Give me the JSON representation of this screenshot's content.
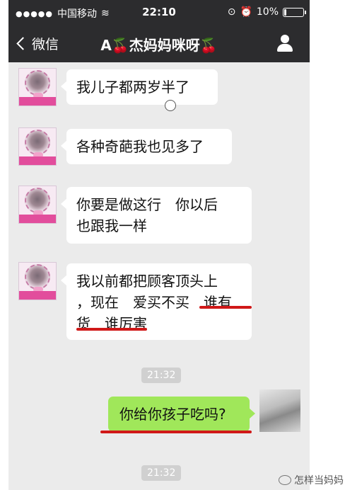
{
  "status_bar": {
    "carrier": "中国移动",
    "time": "22:10",
    "battery": "10%",
    "battery_level": 0.1
  },
  "nav": {
    "back_label": "微信",
    "title_prefix": "A",
    "title_cherry": "🍒",
    "title_name": "杰妈妈咪呀",
    "title_suffix": "🍒"
  },
  "messages": [
    {
      "side": "left",
      "text": "我儿子都两岁半了"
    },
    {
      "side": "left",
      "text": "各种奇葩我也见多了"
    },
    {
      "side": "left",
      "lines": [
        "你要是做这行　你以后",
        "也跟我一样"
      ]
    },
    {
      "side": "left",
      "lines": [
        "我以前都把顾客顶头上",
        "，现在　爱买不买　谁有",
        "货　谁厉害"
      ]
    },
    {
      "side": "time",
      "text": "21:32"
    },
    {
      "side": "right",
      "text": "你给你孩子吃吗?"
    },
    {
      "side": "time",
      "text": "21:32"
    }
  ],
  "watermark": "怎样当妈妈",
  "colors": {
    "bar": "#2c2c2e",
    "chat_bg": "#ebebeb",
    "sent_bubble": "#a0e75a",
    "annotation": "#d01818"
  }
}
